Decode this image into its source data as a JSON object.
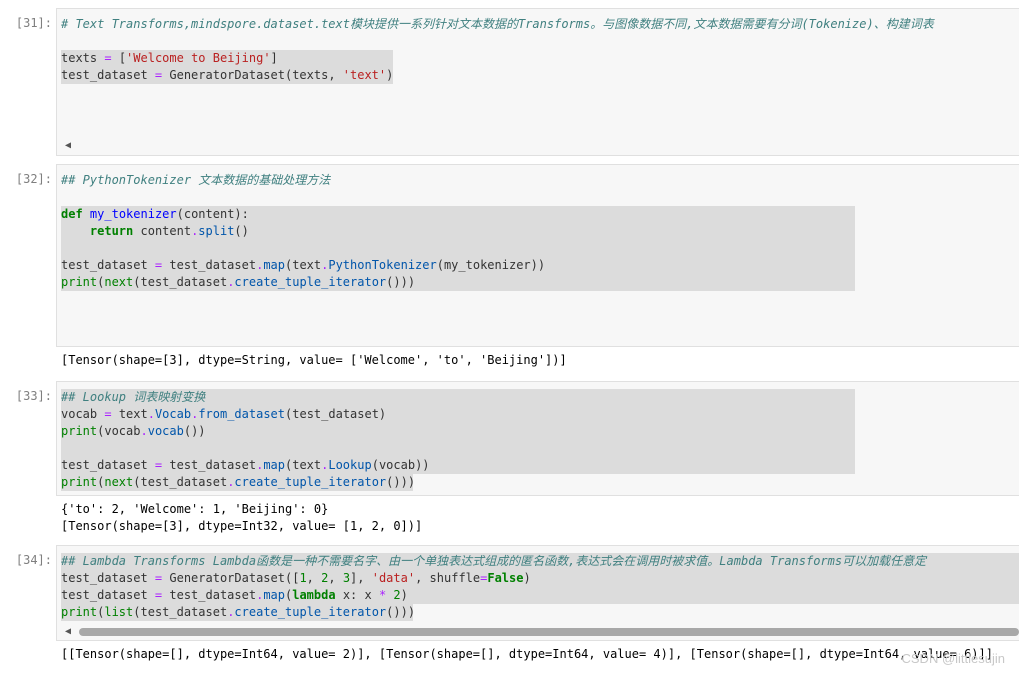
{
  "cells": [
    {
      "prompt": "[31]:",
      "lines": [
        "# Text Transforms,mindspore.dataset.text模块提供一系列针对文本数据的Transforms。与图像数据不同,文本数据需要有分词(Tokenize)、构建词表",
        "",
        "texts = ['Welcome to Beijing']",
        "test_dataset = GeneratorDataset(texts, 'text')"
      ]
    },
    {
      "prompt": "[32]:",
      "lines": [
        "## PythonTokenizer 文本数据的基础处理方法",
        "",
        "def my_tokenizer(content):",
        "    return content.split()",
        "",
        "test_dataset = test_dataset.map(text.PythonTokenizer(my_tokenizer))",
        "print(next(test_dataset.create_tuple_iterator()))"
      ],
      "output": [
        "[Tensor(shape=[3], dtype=String, value= ['Welcome', 'to', 'Beijing'])]"
      ]
    },
    {
      "prompt": "[33]:",
      "lines": [
        "## Lookup 词表映射变换",
        "vocab = text.Vocab.from_dataset(test_dataset)",
        "print(vocab.vocab())",
        "",
        "test_dataset = test_dataset.map(text.Lookup(vocab))",
        "print(next(test_dataset.create_tuple_iterator()))"
      ],
      "output": [
        "{'to': 2, 'Welcome': 1, 'Beijing': 0}",
        "[Tensor(shape=[3], dtype=Int32, value= [1, 2, 0])]"
      ]
    },
    {
      "prompt": "[34]:",
      "lines": [
        "## Lambda Transforms Lambda函数是一种不需要名字、由一个单独表达式组成的匿名函数,表达式会在调用时被求值。Lambda Transforms可以加载任意定",
        "test_dataset = GeneratorDataset([1, 2, 3], 'data', shuffle=False)",
        "test_dataset = test_dataset.map(lambda x: x * 2)",
        "print(list(test_dataset.create_tuple_iterator()))"
      ],
      "output": [
        "[[Tensor(shape=[], dtype=Int64, value= 2)], [Tensor(shape=[], dtype=Int64, value= 4)], [Tensor(shape=[], dtype=Int64, value= 6)]]"
      ]
    }
  ],
  "watermark": "CSDN @littlesujin",
  "icons": {
    "scroll_left": "◀"
  }
}
